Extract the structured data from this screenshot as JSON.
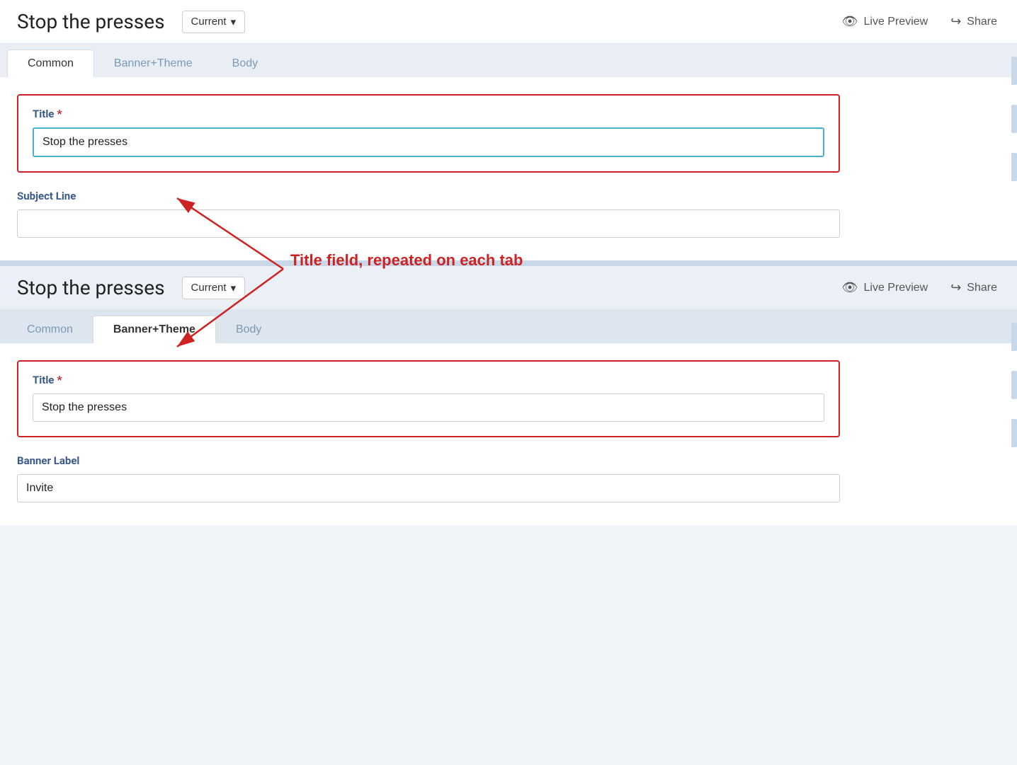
{
  "header": {
    "title": "Stop the presses",
    "version_label": "Current",
    "chevron": "▾",
    "live_preview_label": "Live Preview",
    "share_label": "Share"
  },
  "tabs": [
    {
      "id": "common",
      "label": "Common"
    },
    {
      "id": "banner-theme",
      "label": "Banner+Theme"
    },
    {
      "id": "body",
      "label": "Body"
    }
  ],
  "panel1": {
    "active_tab": "Common",
    "title_label": "Title",
    "title_value": "Stop the presses",
    "title_placeholder": "",
    "subject_label": "Subject Line",
    "subject_value": "",
    "subject_placeholder": ""
  },
  "panel2": {
    "active_tab": "Banner+Theme",
    "title_label": "Title",
    "title_value": "Stop the presses",
    "title_placeholder": "",
    "banner_label": "Banner Label",
    "banner_value": "Invite",
    "banner_placeholder": ""
  },
  "annotation": {
    "text": "Title field, repeated on each tab"
  }
}
